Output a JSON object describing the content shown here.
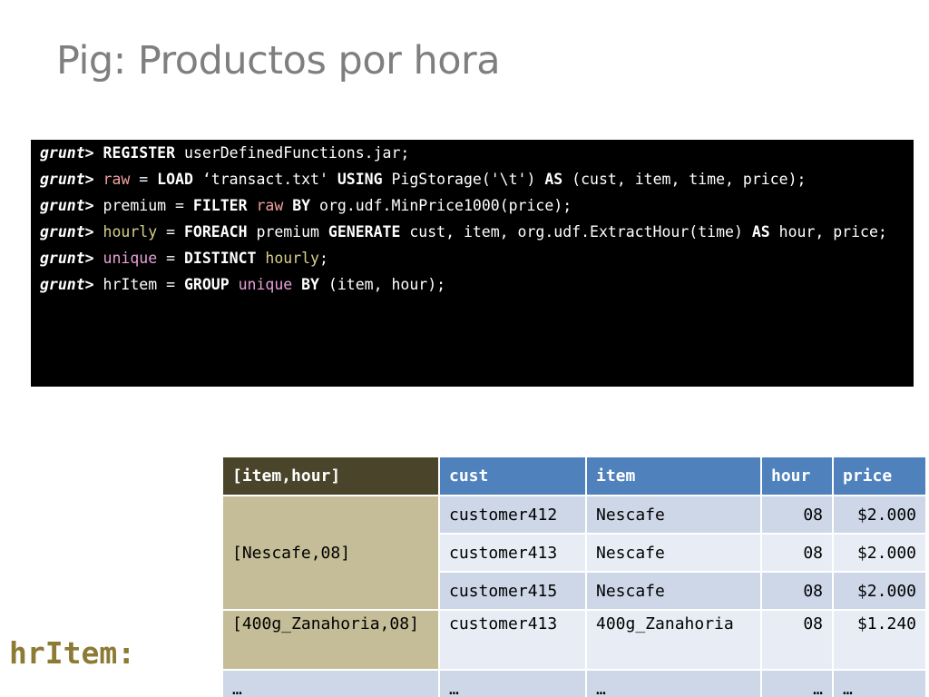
{
  "title": "Pig: Productos por hora",
  "code": {
    "prompt": "grunt>",
    "lines": {
      "l1": {
        "kw1": "REGISTER",
        "rest": " userDefinedFunctions.jar;"
      },
      "l2": {
        "var": "raw",
        "eq": " = ",
        "kw1": "LOAD",
        "mid1": " ‘transact.txt' ",
        "kw2": "USING",
        "mid2": " PigStorage('\\t') ",
        "kw3": "AS",
        "rest": " (cust, item, time, price);"
      },
      "l3": {
        "var": "premium",
        "eq": " = ",
        "kw1": "FILTER",
        "sp": " ",
        "var2": "raw",
        "sp2": " ",
        "kw2": "BY",
        "rest": " org.udf.MinPrice1000(price);"
      },
      "l4": {
        "var": "hourly",
        "eq": " = ",
        "kw1": "FOREACH",
        "mid1": " premium ",
        "kw2": "GENERATE",
        "mid2": " cust, item, org.udf.ExtractHour(time) ",
        "kw3": "AS",
        "rest": " hour, price;"
      },
      "l5": {
        "var": "unique",
        "eq": " = ",
        "kw1": "DISTINCT",
        "sp": " ",
        "var2": "hourly",
        "rest": ";"
      },
      "l6": {
        "var": "hrItem",
        "eq": " = ",
        "kw1": "GROUP",
        "sp": " ",
        "var2": "unique",
        "sp2": " ",
        "kw2": "BY",
        "rest": " (item, hour);"
      }
    }
  },
  "result": {
    "label": "hrItem:",
    "headers": [
      "[item,hour]",
      "cust",
      "item",
      "hour",
      "price"
    ],
    "groups": [
      {
        "key": "[Nescafe,08]",
        "rows": [
          {
            "cust": "customer412",
            "item": "Nescafe",
            "hour": "08",
            "price": "$2.000"
          },
          {
            "cust": "customer413",
            "item": "Nescafe",
            "hour": "08",
            "price": "$2.000"
          },
          {
            "cust": "customer415",
            "item": "Nescafe",
            "hour": "08",
            "price": "$2.000"
          }
        ]
      },
      {
        "key": "[400g_Zanahoria,08]",
        "rows": [
          {
            "cust": "customer413",
            "item": "400g_Zanahoria",
            "hour": "08",
            "price": "$1.240"
          }
        ]
      },
      {
        "key": "…",
        "rows": [
          {
            "cust": "…",
            "item": "…",
            "hour": "…",
            "price": "…"
          }
        ]
      }
    ]
  }
}
